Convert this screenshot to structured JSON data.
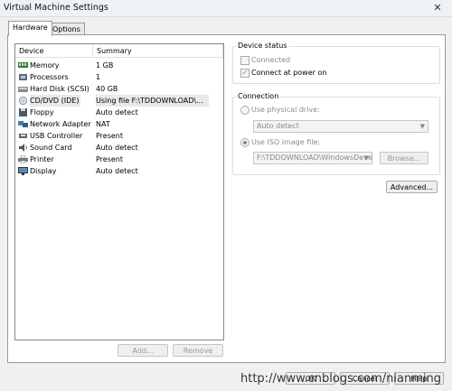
{
  "window": {
    "title": "Virtual Machine Settings"
  },
  "tabs": [
    {
      "label": "Hardware"
    },
    {
      "label": "Options"
    }
  ],
  "device_list": {
    "columns": [
      "Device",
      "Summary"
    ],
    "rows": [
      {
        "device": "Memory",
        "summary": "1 GB",
        "icon": "memory-icon"
      },
      {
        "device": "Processors",
        "summary": "1",
        "icon": "processor-icon"
      },
      {
        "device": "Hard Disk (SCSI)",
        "summary": "40 GB",
        "icon": "hard-disk-icon"
      },
      {
        "device": "CD/DVD (IDE)",
        "summary": "Using file F:\\TDDOWNLOAD\\...",
        "icon": "cd-dvd-icon",
        "selected": true
      },
      {
        "device": "Floppy",
        "summary": "Auto detect",
        "icon": "floppy-icon"
      },
      {
        "device": "Network Adapter",
        "summary": "NAT",
        "icon": "network-adapter-icon"
      },
      {
        "device": "USB Controller",
        "summary": "Present",
        "icon": "usb-icon"
      },
      {
        "device": "Sound Card",
        "summary": "Auto detect",
        "icon": "sound-card-icon"
      },
      {
        "device": "Printer",
        "summary": "Present",
        "icon": "printer-icon"
      },
      {
        "device": "Display",
        "summary": "Auto detect",
        "icon": "display-icon"
      }
    ]
  },
  "buttons": {
    "add": "Add...",
    "remove": "Remove",
    "advanced": "Advanced...",
    "browse": "Browse...",
    "ok": "OK",
    "cancel": "Cancel",
    "help": "Help"
  },
  "device_status": {
    "label": "Device status",
    "connected": {
      "label": "Connected",
      "checked": false
    },
    "connect_at_power_on": {
      "label": "Connect at power on",
      "checked": true
    }
  },
  "connection": {
    "label": "Connection",
    "physical": {
      "label": "Use physical drive:",
      "selected": false,
      "value": "Auto detect"
    },
    "iso": {
      "label": "Use ISO image file:",
      "selected": true,
      "value": "F:\\TDDOWNLOAD\\WindowsDeve"
    }
  },
  "watermark": "http://www.cnblogs.com/nianming"
}
